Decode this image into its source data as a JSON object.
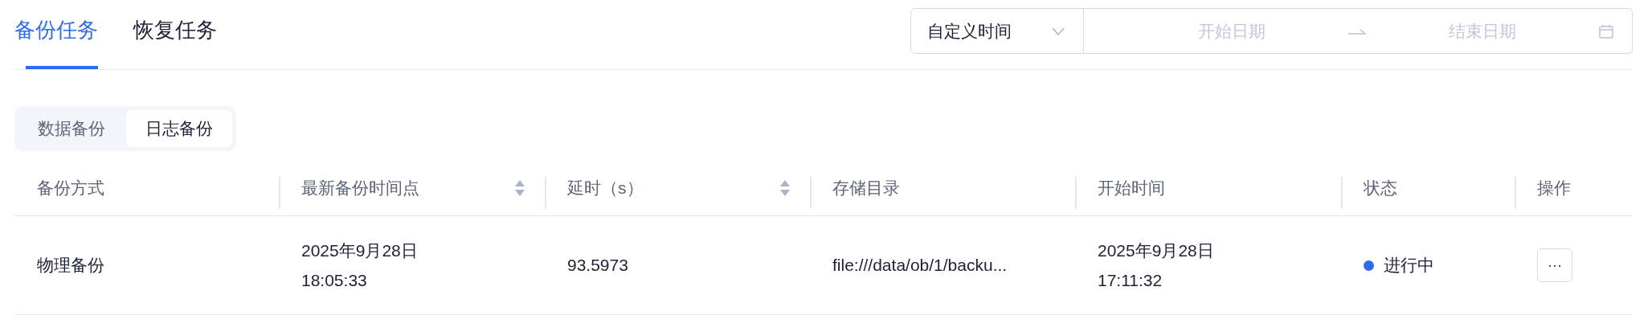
{
  "tabs": [
    {
      "label": "备份任务",
      "selected": true
    },
    {
      "label": "恢复任务",
      "selected": false
    }
  ],
  "date_filter": {
    "mode": "自定义时间",
    "start_placeholder": "开始日期",
    "end_placeholder": "结束日期"
  },
  "segments": [
    {
      "label": "数据备份",
      "selected": false
    },
    {
      "label": "日志备份",
      "selected": true
    }
  ],
  "table": {
    "columns": [
      {
        "label": "备份方式",
        "sortable": false
      },
      {
        "label": "最新备份时间点",
        "sortable": true
      },
      {
        "label": "延时（s）",
        "sortable": true
      },
      {
        "label": "存储目录",
        "sortable": false
      },
      {
        "label": "开始时间",
        "sortable": false
      },
      {
        "label": "状态",
        "sortable": false
      },
      {
        "label": "操作",
        "sortable": false
      }
    ],
    "rows": [
      {
        "method": "物理备份",
        "latest_backup": [
          "2025年9月28日",
          "18:05:33"
        ],
        "delay": "93.5973",
        "storage_dir": "file:///data/ob/1/backu...",
        "start_time": [
          "2025年9月28日",
          "17:11:32"
        ],
        "status": {
          "label": "进行中",
          "color": "#2f6bf0"
        },
        "action": "···"
      }
    ]
  }
}
